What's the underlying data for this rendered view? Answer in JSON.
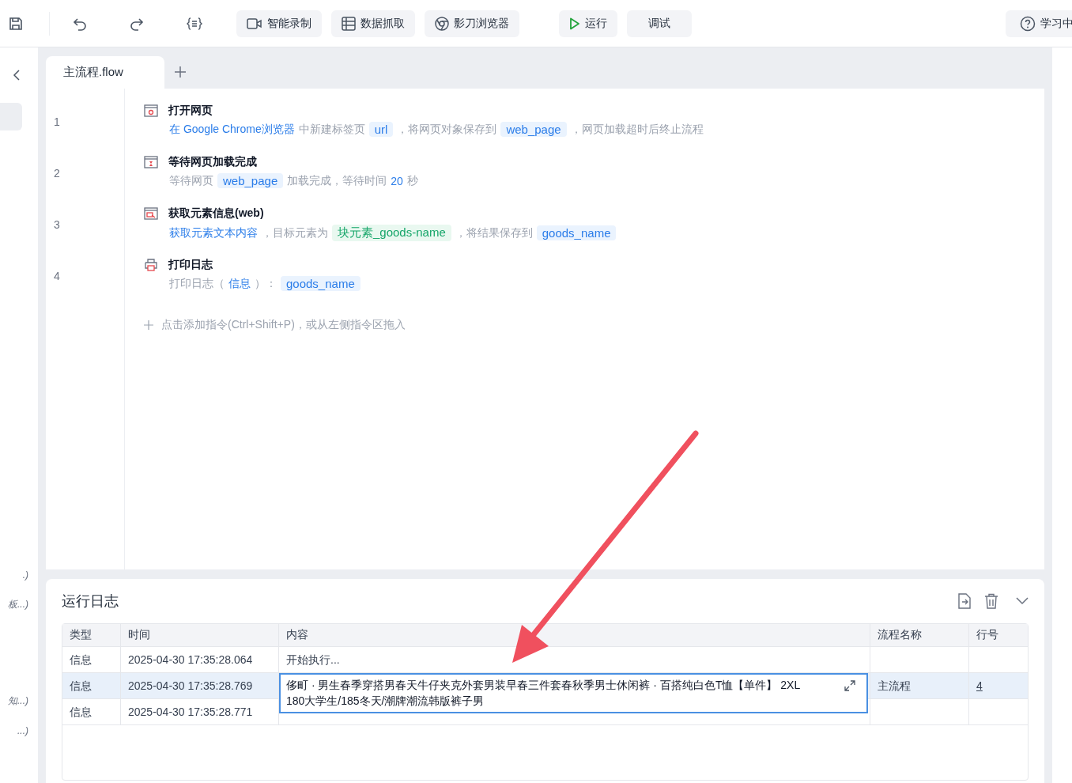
{
  "toolbar": {
    "tools": [
      {
        "kind": "record",
        "label": "智能录制"
      },
      {
        "kind": "table",
        "label": "数据抓取"
      },
      {
        "kind": "browser",
        "label": "影刀浏览器"
      }
    ],
    "run": {
      "label": "运行"
    },
    "debug": {
      "label": "调试"
    },
    "help": {
      "label": "学习中"
    }
  },
  "sidebar": {
    "fragments": [
      ".)",
      "板...)",
      "知...)",
      "...)"
    ]
  },
  "tabs": [
    {
      "label": "主流程.flow",
      "selected": true
    }
  ],
  "steps": [
    {
      "line": "1",
      "kind": "open",
      "title": "打开网页",
      "parts": [
        {
          "kind": "link",
          "text": "在 Google Chrome浏览器"
        },
        {
          "kind": "plain",
          "text": "中新建标签页"
        },
        {
          "kind": "var",
          "text": "url"
        },
        {
          "kind": "plain",
          "text": "，将网页对象保存到"
        },
        {
          "kind": "var",
          "text": "web_page"
        },
        {
          "kind": "plain",
          "text": "，网页加载超时后终止流程"
        }
      ]
    },
    {
      "line": "2",
      "kind": "wait",
      "title": "等待网页加载完成",
      "parts": [
        {
          "kind": "plain",
          "text": "等待网页"
        },
        {
          "kind": "var",
          "text": "web_page"
        },
        {
          "kind": "plain",
          "text": "加载完成，等待时间"
        },
        {
          "kind": "link",
          "text": "20"
        },
        {
          "kind": "plain",
          "text": "秒"
        }
      ]
    },
    {
      "line": "3",
      "kind": "extract",
      "title": "获取元素信息(web)",
      "parts": [
        {
          "kind": "link",
          "text": "获取元素文本内容"
        },
        {
          "kind": "plain",
          "text": "，目标元素为"
        },
        {
          "kind": "element",
          "text": "块元素_goods-name"
        },
        {
          "kind": "plain",
          "text": "，将结果保存到"
        },
        {
          "kind": "var",
          "text": "goods_name"
        }
      ]
    },
    {
      "line": "4",
      "kind": "print",
      "title": "打印日志",
      "parts": [
        {
          "kind": "plain",
          "text": "打印日志（"
        },
        {
          "kind": "link",
          "text": "信息"
        },
        {
          "kind": "plain",
          "text": "）："
        },
        {
          "kind": "var",
          "text": "goods_name"
        }
      ]
    }
  ],
  "add_hint": "点击添加指令(Ctrl+Shift+P)，或从左侧指令区拖入",
  "log": {
    "title": "运行日志",
    "columns": [
      "类型",
      "时间",
      "内容",
      "流程名称",
      "行号"
    ],
    "rows": [
      {
        "type": "信息",
        "time": "2025-04-30 17:35:28.064",
        "content": "开始执行...",
        "flow": "",
        "line": "",
        "selected": false,
        "expanded": false
      },
      {
        "type": "信息",
        "time": "2025-04-30 17:35:28.769",
        "content": "侈町 · 男生春季穿搭男春天牛仔夹克外套男装早春三件套春秋季男士休闲裤 · 百搭纯白色T恤【单件】 2XL 180大学生/185冬天/潮牌潮流韩版裤子男",
        "flow": "主流程",
        "line": "4",
        "selected": true,
        "expanded": true
      },
      {
        "type": "信息",
        "time": "2025-04-30 17:35:28.771",
        "content": "",
        "flow": "",
        "line": "",
        "selected": false,
        "expanded": false
      }
    ]
  }
}
